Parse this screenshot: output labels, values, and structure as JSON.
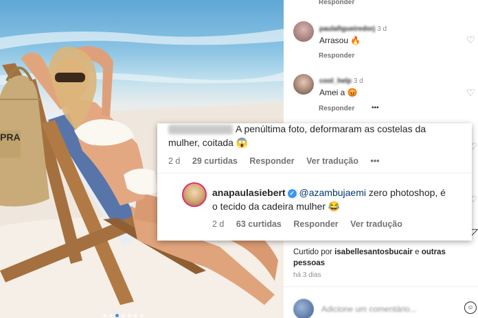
{
  "photo": {
    "alt_label": "",
    "bag_text": "PRA"
  },
  "comments": [
    {
      "reply": "Responder"
    },
    {
      "username": "paulafigueiredorj",
      "age": "3 d",
      "text": "Arrasou",
      "emoji": "🔥",
      "reply": "Responder"
    },
    {
      "username": "cool_help",
      "age": "3 d",
      "text": "Amei a",
      "emoji": "😡",
      "reply": "Responder",
      "more": "•••"
    }
  ],
  "card": {
    "comment1": {
      "line1": "A penúltima foto, deformaram as costelas da",
      "line2": "mulher, coitada",
      "emoji": "😱",
      "age": "2 d",
      "likes": "29 curtidas",
      "reply": "Responder",
      "translate": "Ver tradução",
      "more": "•••"
    },
    "comment2": {
      "username": "anapaulasiebert",
      "verified": "✓",
      "mention": "@azambujaemi",
      "line1": "zero photoshop, é",
      "line2": "o tecido da cadeira mulher",
      "emoji": "😂",
      "age": "2 d",
      "likes": "63 curtidas",
      "reply": "Responder",
      "translate": "Ver tradução"
    }
  },
  "liked_by": {
    "prefix": "Curtido por",
    "user": "isabellesantosbucair",
    "and": "e",
    "others": "outras",
    "others2": "pessoas",
    "age": "há 3 dias"
  },
  "add_comment": {
    "placeholder": "Adicione um comentário..."
  },
  "icons": {
    "heart": "♡",
    "emoji": "☺",
    "save": "◸"
  },
  "colors": {
    "text": "#262626",
    "muted": "#737373",
    "verified": "#3897f0",
    "link": "#00376b"
  }
}
